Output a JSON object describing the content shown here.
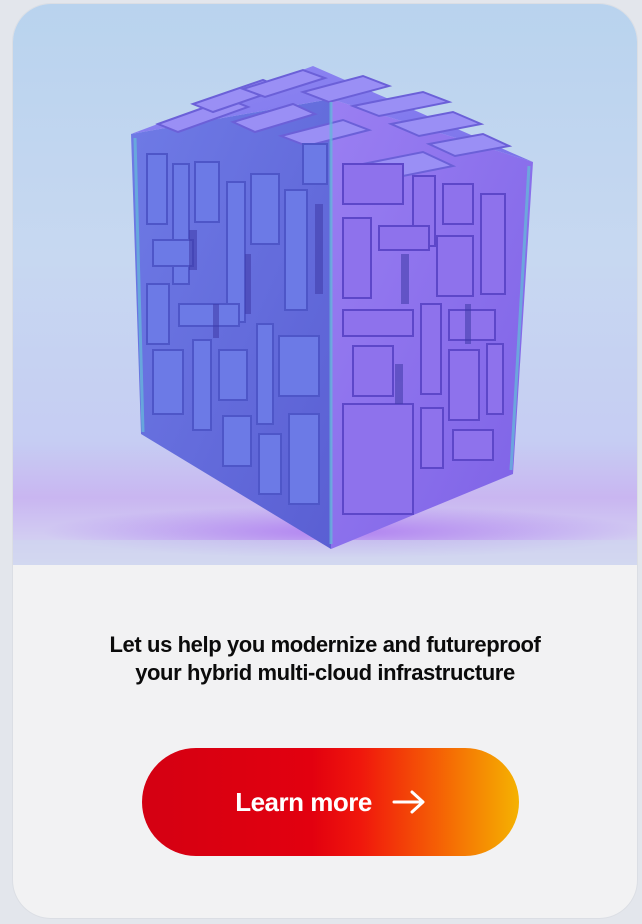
{
  "promo_card": {
    "headline": "Let us help you modernize and futureproof your hybrid multi-cloud infrastructure",
    "cta_label": "Learn more",
    "cta_icon": "arrow-right-icon",
    "hero_illustration": "modular-cube-illustration"
  },
  "colors": {
    "card_background": "#f2f2f3",
    "page_background": "#e3e6ec",
    "headline_text": "#0b0b0b",
    "cta_gradient_start": "#d40012",
    "cta_gradient_mid": "#e2000f",
    "cta_gradient_end": "#f5b201",
    "cta_text": "#ffffff",
    "cube_face_light": "#8a7ef0",
    "cube_face_dark": "#5b55d6",
    "cube_edge_teal": "#5fa7d6"
  }
}
